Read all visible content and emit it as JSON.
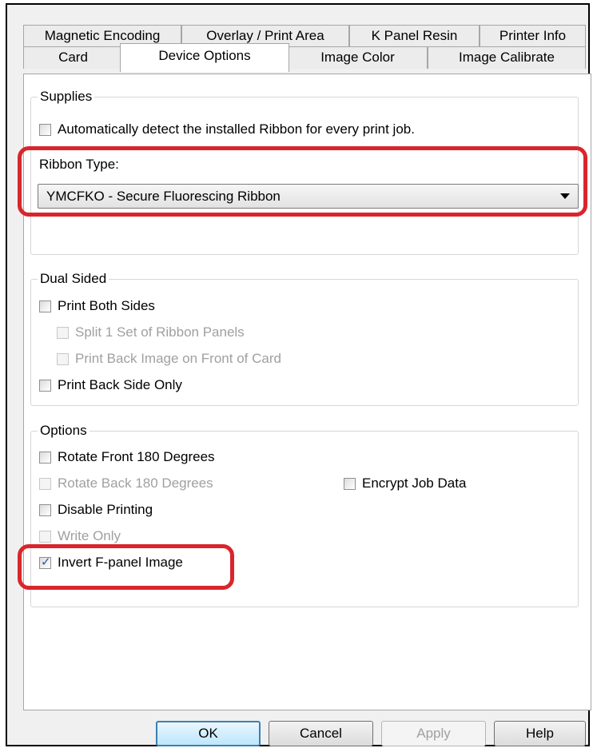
{
  "tabs_row1": [
    "Magnetic Encoding",
    "Overlay / Print Area",
    "K Panel Resin",
    "Printer Info"
  ],
  "tabs_row2": [
    "Card",
    "Device Options",
    "Image Color",
    "Image Calibrate"
  ],
  "active_tab": "Device Options",
  "supplies": {
    "legend": "Supplies",
    "auto_detect": {
      "label": "Automatically detect the installed Ribbon for every print job.",
      "checked": false
    },
    "ribbon_type_label": "Ribbon Type:",
    "ribbon_type_value": "YMCFKO - Secure Fluorescing Ribbon"
  },
  "dual_sided": {
    "legend": "Dual Sided",
    "print_both_sides": {
      "label": "Print Both Sides",
      "checked": false
    },
    "split_panels": {
      "label": "Split 1 Set of Ribbon Panels",
      "checked": false,
      "disabled": true
    },
    "print_back_on_front": {
      "label": "Print Back Image on Front of Card",
      "checked": false,
      "disabled": true
    },
    "print_back_only": {
      "label": "Print Back Side Only",
      "checked": false
    }
  },
  "options": {
    "legend": "Options",
    "rotate_front": {
      "label": "Rotate Front 180 Degrees",
      "checked": false
    },
    "rotate_back": {
      "label": "Rotate Back 180 Degrees",
      "checked": false,
      "disabled": true
    },
    "encrypt_job": {
      "label": "Encrypt Job Data",
      "checked": false
    },
    "disable_printing": {
      "label": "Disable Printing",
      "checked": false
    },
    "write_only": {
      "label": "Write Only",
      "checked": false,
      "disabled": true
    },
    "invert_fpanel": {
      "label": "Invert F-panel Image",
      "checked": true
    }
  },
  "buttons": {
    "ok": "OK",
    "cancel": "Cancel",
    "apply": "Apply",
    "help": "Help"
  },
  "colors": {
    "highlight": "#d8262c",
    "checkmark": "#2c57a8"
  }
}
